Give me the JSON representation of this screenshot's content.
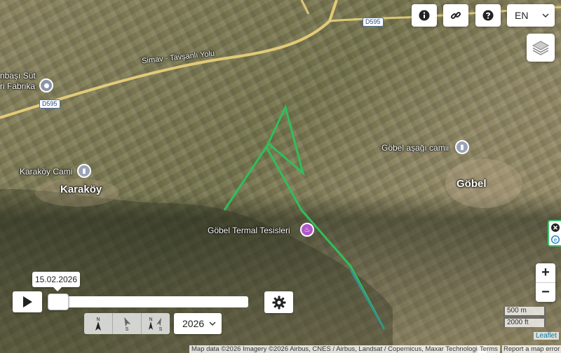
{
  "map": {
    "places": [
      {
        "id": "pinarbasi",
        "text": "nbaşı Süt"
      },
      {
        "id": "fabrika",
        "text": "ri Fabrika"
      },
      {
        "id": "karakoy_cami",
        "text": "Karaköy Cami"
      },
      {
        "id": "karakoy",
        "text": "Karaköy"
      },
      {
        "id": "gobel_asagi_camii",
        "text": "Göbel aşağı camii"
      },
      {
        "id": "gobel",
        "text": "Göbel"
      },
      {
        "id": "gobel_termal",
        "text": "Göbel Termal Tesisleri"
      },
      {
        "id": "road_name",
        "text": "Simav - Tavşanlı Yolu"
      }
    ],
    "road_shields": [
      "D595",
      "D595"
    ],
    "track_color": "#2fbf5a"
  },
  "controls": {
    "info_icon": "info-icon",
    "link_icon": "link-icon",
    "help_icon": "help-icon",
    "language": "EN",
    "layers_icon": "layers-icon",
    "zoom_in": "+",
    "zoom_out": "−"
  },
  "scale": {
    "metric": "500 m",
    "imperial": "2000 ft"
  },
  "attribution": {
    "text": "Map data ©2026 Imagery ©2026 Airbus, CNES / Airbus, Landsat / Copernicus, Maxar Technologies",
    "terms": "Terms",
    "report": "Report a map error",
    "leaflet": "Leaflet"
  },
  "timeline": {
    "date": "15.02.2026",
    "progress": 0.0,
    "year": "2026"
  }
}
